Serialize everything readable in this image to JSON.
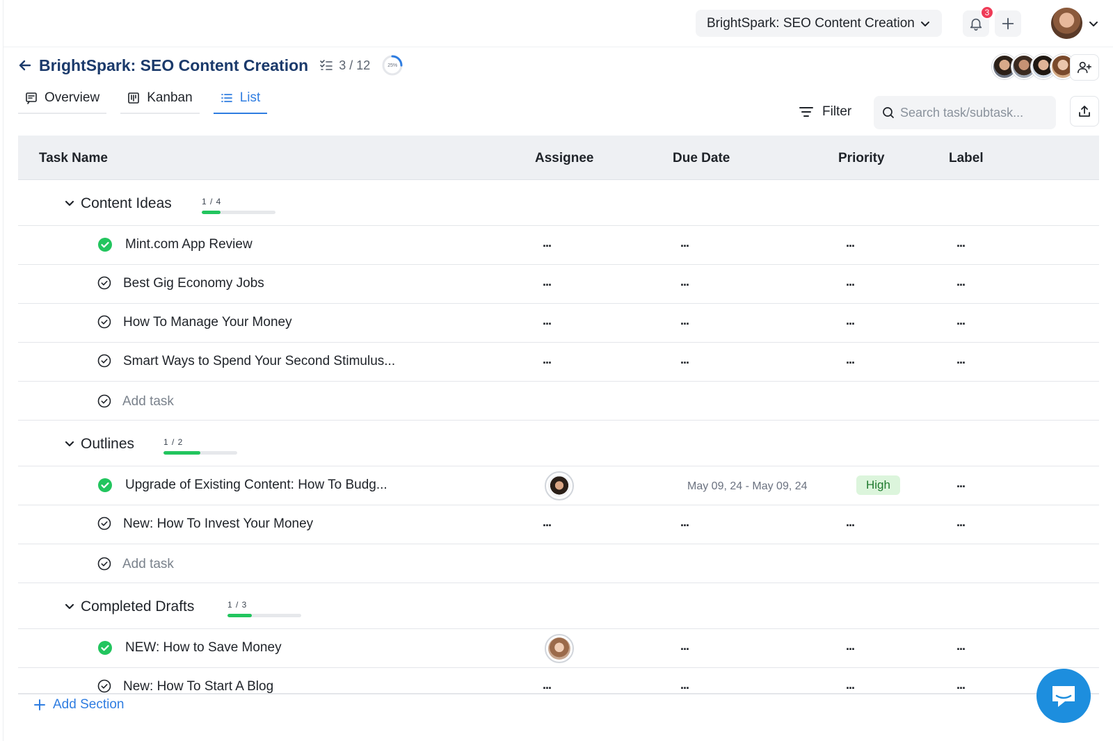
{
  "topbar": {
    "project_selector": "BrightSpark: SEO Content Creation",
    "notification_count": "3"
  },
  "header": {
    "title": "BrightSpark: SEO Content Creation",
    "task_count": "3 / 12",
    "progress_label": "25%",
    "progress_fraction": 0.25
  },
  "tabs": [
    {
      "label": "Overview",
      "icon": "overview-icon",
      "active": false
    },
    {
      "label": "Kanban",
      "icon": "kanban-icon",
      "active": false
    },
    {
      "label": "List",
      "icon": "list-icon",
      "active": true
    }
  ],
  "toolbar": {
    "filter_label": "Filter",
    "search_placeholder": "Search task/subtask..."
  },
  "columns": [
    "Task Name",
    "Assignee",
    "Due Date",
    "Priority",
    "Label"
  ],
  "sections": [
    {
      "name": "Content Ideas",
      "count": "1 / 4",
      "progress": 0.25,
      "tasks": [
        {
          "name": "Mint.com App Review",
          "done": true,
          "assignee": null,
          "due": null,
          "priority": null
        },
        {
          "name": "Best Gig Economy Jobs",
          "done": false,
          "assignee": null,
          "due": null,
          "priority": null
        },
        {
          "name": "How To Manage Your Money",
          "done": false,
          "assignee": null,
          "due": null,
          "priority": null
        },
        {
          "name": "Smart Ways to Spend Your Second Stimulus...",
          "done": false,
          "assignee": null,
          "due": null,
          "priority": null
        }
      ],
      "add_task": "Add task"
    },
    {
      "name": "Outlines",
      "count": "1 / 2",
      "progress": 0.5,
      "tasks": [
        {
          "name": "Upgrade of Existing Content: How To Budg...",
          "done": true,
          "assignee": "man-avatar",
          "due": "May 09, 24 - May 09, 24",
          "priority": "High"
        },
        {
          "name": "New: How To Invest Your Money",
          "done": false,
          "assignee": null,
          "due": null,
          "priority": null
        }
      ],
      "add_task": "Add task"
    },
    {
      "name": "Completed Drafts",
      "count": "1 / 3",
      "progress": 0.33,
      "tasks": [
        {
          "name": "NEW: How to Save Money",
          "done": true,
          "assignee": "woman-avatar",
          "due": null,
          "priority": null
        },
        {
          "name": "New: How To Start A Blog",
          "done": false,
          "assignee": null,
          "due": null,
          "priority": null
        }
      ]
    }
  ],
  "placeholder": "...",
  "footer": {
    "add_section": "Add Section"
  },
  "colors": {
    "accent": "#2f7de1",
    "title": "#1b3a6b",
    "done_green": "#22c55e",
    "badge_red": "#ef3b57",
    "priority_high_bg": "#dcf5dc",
    "chat_fab": "#1d8ede"
  }
}
